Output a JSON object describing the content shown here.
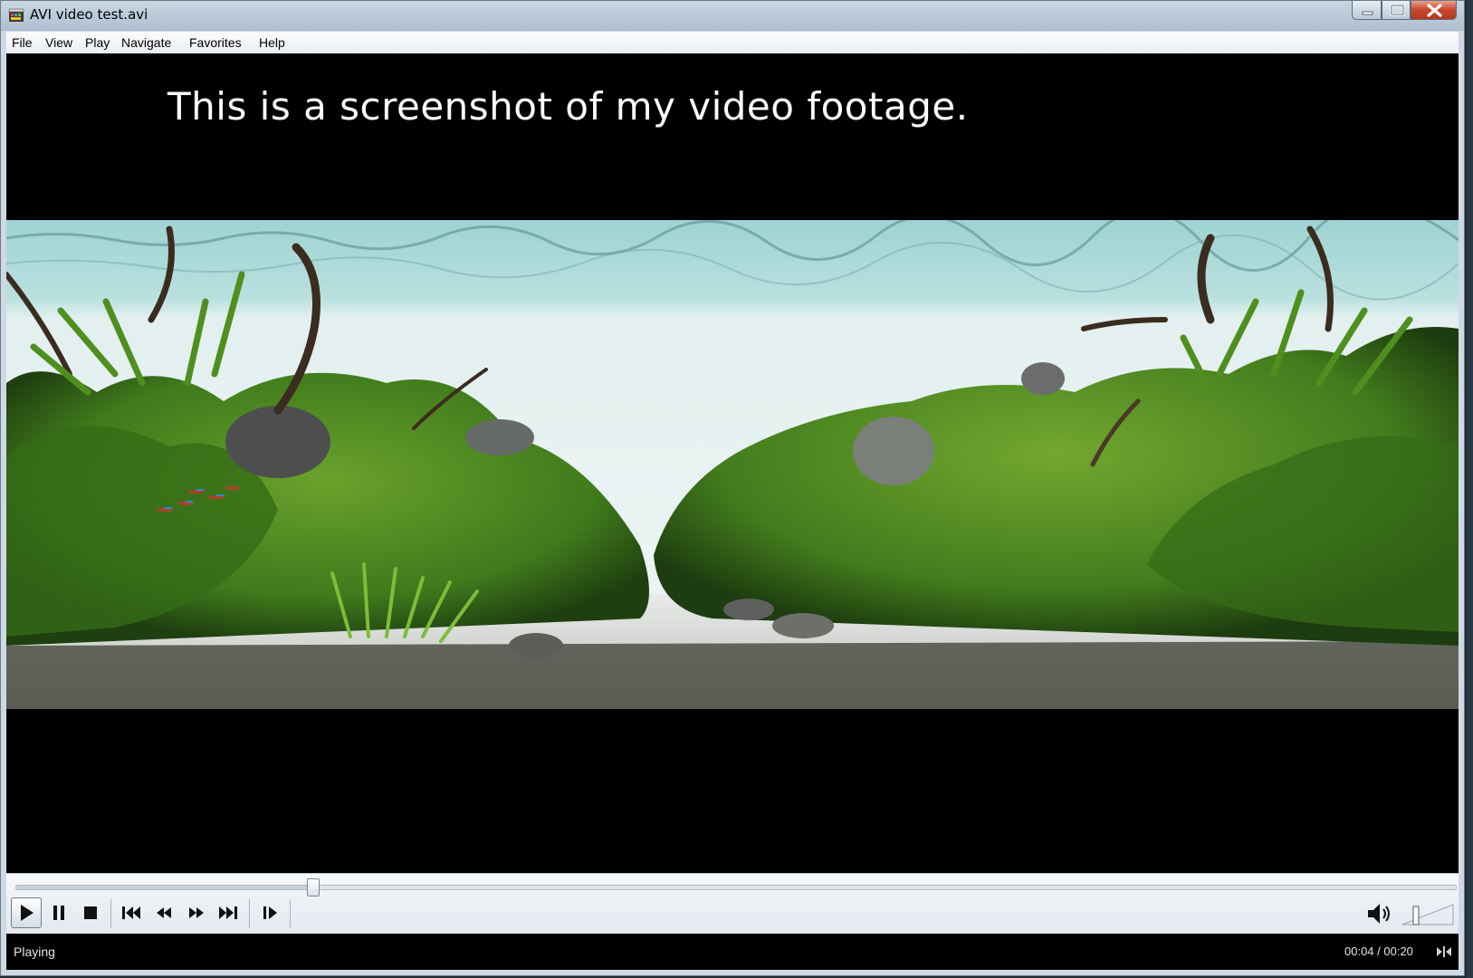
{
  "window": {
    "title": "AVI video test.avi"
  },
  "menu": {
    "items": [
      "File",
      "View",
      "Play",
      "Navigate",
      "Favorites",
      "Help"
    ]
  },
  "video": {
    "overlay_text": "This is a screenshot of my video footage."
  },
  "playback": {
    "seek_fraction": 0.206
  },
  "controls": {
    "buttons": [
      "play-icon",
      "pause-icon",
      "stop-icon",
      "skip-previous-icon",
      "rewind-icon",
      "fast-forward-icon",
      "skip-next-icon",
      "frame-step-icon"
    ],
    "volume_icon": "speaker-icon"
  },
  "status": {
    "state": "Playing",
    "time": "00:04 / 00:20"
  },
  "colors": {
    "menubar_bg": "#f3f6f9",
    "video_bg": "#000000",
    "close_button": "#c7472c"
  }
}
